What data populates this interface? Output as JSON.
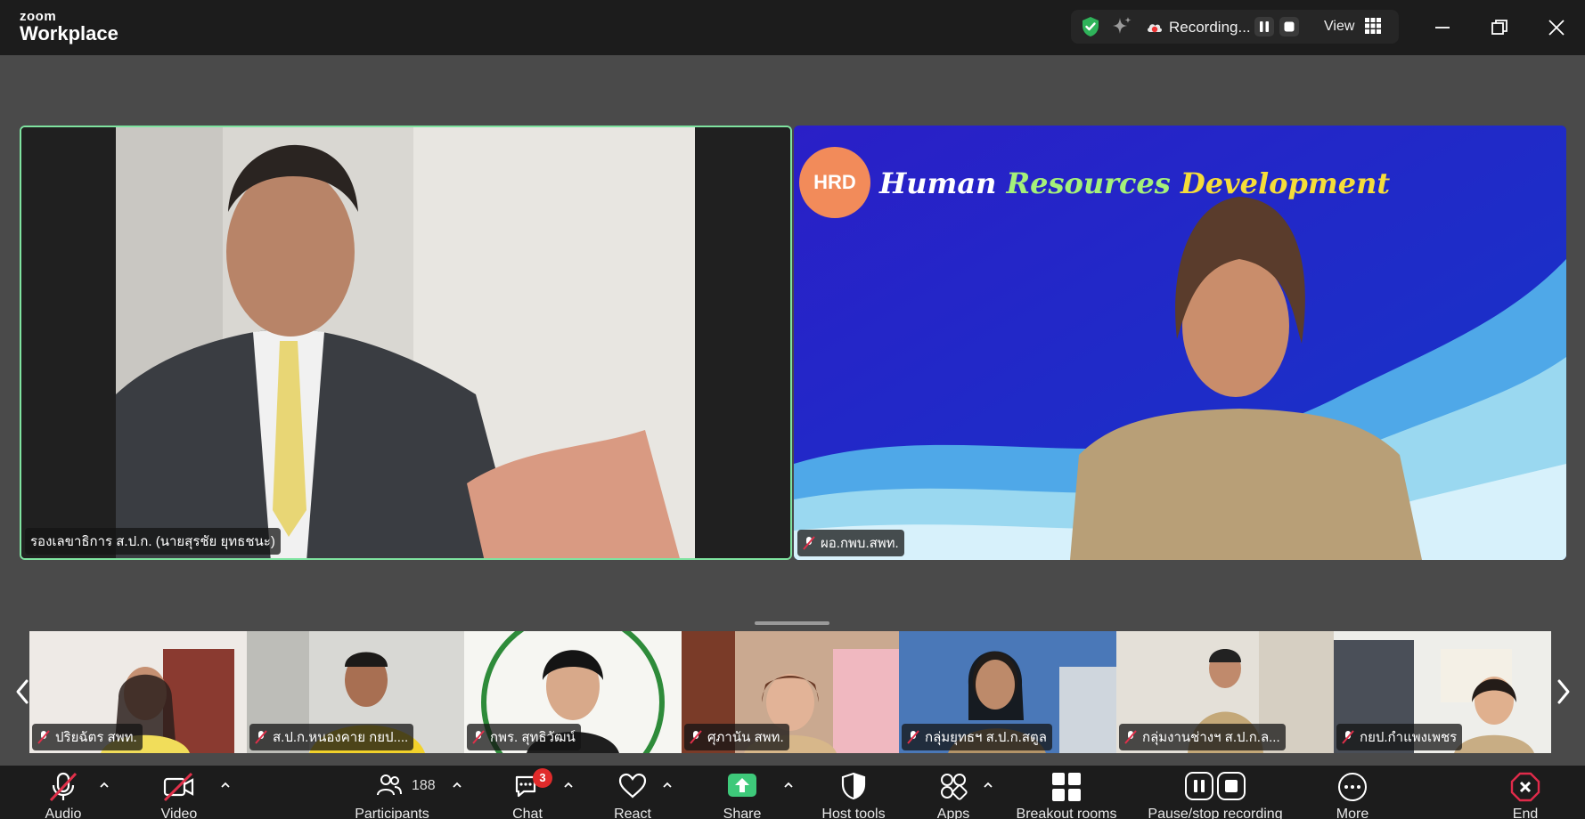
{
  "app": {
    "logo_line1": "zoom",
    "logo_line2": "Workplace"
  },
  "status": {
    "recording_label": "Recording...",
    "view_label": "View"
  },
  "main_tiles": [
    {
      "name": "รองเลขาธิการ ส.ป.ก. (นายสุรชัย ยุทธชนะ)",
      "active_speaker": true
    },
    {
      "name": "ผอ.กพบ.สพท.",
      "muted": true,
      "banner": {
        "logo": "HRD",
        "word1": "Human",
        "word2": "Resources",
        "word3": "Development"
      }
    }
  ],
  "thumbnails": [
    {
      "name": "ปริยฉัตร สพท."
    },
    {
      "name": "ส.ป.ก.หนองคาย กยป...."
    },
    {
      "name": "กพร. สุทธิวัฒน์"
    },
    {
      "name": "ศุภานัน สพท."
    },
    {
      "name": "กลุ่มยุทธฯ ส.ป.ก.สตูล"
    },
    {
      "name": "กลุ่มงานช่างฯ ส.ป.ก.ล..."
    },
    {
      "name": "กยป.กำแพงเพชร"
    }
  ],
  "toolbar": {
    "audio": "Audio",
    "video": "Video",
    "participants": "Participants",
    "participants_count": "188",
    "chat": "Chat",
    "chat_badge": "3",
    "react": "React",
    "share": "Share",
    "host_tools": "Host tools",
    "apps": "Apps",
    "breakout": "Breakout rooms",
    "pause_recording": "Pause/stop recording",
    "more": "More",
    "end": "End"
  },
  "colors": {
    "active_speaker_border": "#7fe3a0",
    "share_green": "#3ec97a",
    "mute_red": "#e0304a",
    "end_red": "#e02b4a"
  }
}
